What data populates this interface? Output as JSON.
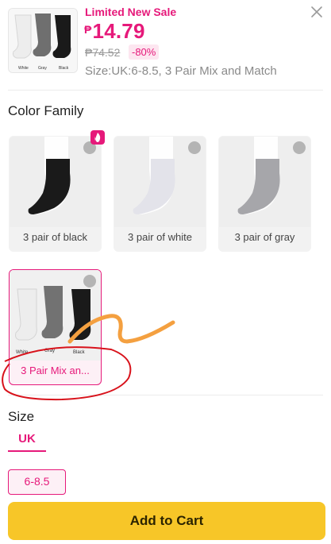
{
  "product": {
    "sale_label": "Limited New Sale",
    "currency": "₱",
    "price": "14.79",
    "old_price": "₱74.52",
    "discount": "-80%",
    "size_summary": "Size:UK:6-8.5, 3 Pair Mix and Match",
    "thumb_sock_labels": [
      "White",
      "Gray",
      "Black"
    ]
  },
  "color_family": {
    "title": "Color Family",
    "options": [
      {
        "label": "3 pair of black",
        "sock_color": "#1a1a1a",
        "selected": false
      },
      {
        "label": "3 pair of white",
        "sock_color": "#e3e3ea",
        "selected": false
      },
      {
        "label": "3 pair of gray",
        "sock_color": "#a6a6aa",
        "selected": false
      },
      {
        "label": "3 Pair Mix an...",
        "selected": true
      }
    ],
    "mix_sock_labels": [
      "White",
      "Gray",
      "Black"
    ]
  },
  "size": {
    "title": "Size",
    "tab": "UK",
    "chip": "6-8.5"
  },
  "cart_button": "Add to Cart",
  "colors": {
    "accent": "#e6197a",
    "cart": "#f7c628",
    "annotation_red": "#d8121b",
    "annotation_orange": "#f4a040"
  },
  "icons": {
    "close": "close-icon",
    "expand": "expand-icon",
    "hot": "fire-icon"
  }
}
